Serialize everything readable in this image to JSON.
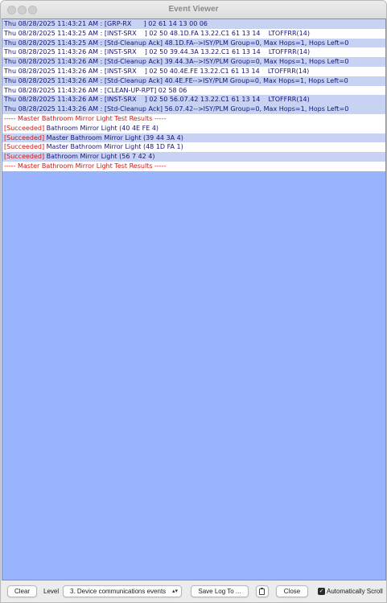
{
  "window": {
    "title": "Event Viewer"
  },
  "log": {
    "rows": [
      {
        "style": "b",
        "text": "Thu 08/28/2025 11:43:21 AM : [GRP-RX      ] 02 61 14 13 00 06"
      },
      {
        "style": "a",
        "text": "Thu 08/28/2025 11:43:25 AM : [INST-SRX    ] 02 50 48.1D.FA 13.22.C1 61 13 14    LTOFFRR(14)"
      },
      {
        "style": "b",
        "text": "Thu 08/28/2025 11:43:25 AM : [Std-Cleanup Ack] 48.1D.FA-->ISY/PLM Group=0, Max Hops=1, Hops Left=0"
      },
      {
        "style": "a",
        "text": "Thu 08/28/2025 11:43:26 AM : [INST-SRX    ] 02 50 39.44.3A 13.22.C1 61 13 14    LTOFFRR(14)"
      },
      {
        "style": "b",
        "text": "Thu 08/28/2025 11:43:26 AM : [Std-Cleanup Ack] 39.44.3A-->ISY/PLM Group=0, Max Hops=1, Hops Left=0"
      },
      {
        "style": "a",
        "text": "Thu 08/28/2025 11:43:26 AM : [INST-SRX    ] 02 50 40.4E.FE 13.22.C1 61 13 14    LTOFFRR(14)"
      },
      {
        "style": "b",
        "text": "Thu 08/28/2025 11:43:26 AM : [Std-Cleanup Ack] 40.4E.FE-->ISY/PLM Group=0, Max Hops=1, Hops Left=0"
      },
      {
        "style": "a",
        "text": "Thu 08/28/2025 11:43:26 AM : [CLEAN-UP-RPT] 02 58 06"
      },
      {
        "style": "b",
        "text": "Thu 08/28/2025 11:43:26 AM : [INST-SRX    ] 02 50 56.07.42 13.22.C1 61 13 14    LTOFFRR(14)"
      },
      {
        "style": "b",
        "text": "Thu 08/28/2025 11:43:26 AM : [Std-Cleanup Ack] 56.07.42-->ISY/PLM Group=0, Max Hops=1, Hops Left=0"
      }
    ],
    "header": "----- Master Bathroom Mirror Light Test Results -----",
    "results": [
      {
        "style": "a",
        "status": "[Succeeded]",
        "name": " Bathroom Mirror Light (40 4E FE 4)"
      },
      {
        "style": "b",
        "status": "[Succeeded]",
        "name": " Master Bathroom Mirror Light (39 44 3A 4)"
      },
      {
        "style": "a",
        "status": "[Succeeded]",
        "name": " Master Bathroom Mirror Light (48 1D FA 1)"
      },
      {
        "style": "b",
        "status": "[Succeeded]",
        "name": " Bathroom Mirror Light (56 7 42 4)"
      }
    ],
    "footer": "----- Master Bathroom Mirror Light Test Results -----"
  },
  "toolbar": {
    "clear_label": "Clear",
    "level_label": "Level",
    "level_value": "3. Device communications events",
    "save_label": "Save Log To ...",
    "close_label": "Close",
    "autoscroll_label": "Automatically Scroll",
    "autoscroll_checked": true
  },
  "icons": {
    "level_dropdown": "chevron-updown-icon",
    "clipboard": "clipboard-icon",
    "autoscroll_check": "checkmark-icon"
  },
  "colors": {
    "log_background": "#99b4ff",
    "row_white": "#ffffff",
    "row_blue": "#c8d2f3",
    "text_blue": "#15157a",
    "text_red": "#d41414"
  }
}
